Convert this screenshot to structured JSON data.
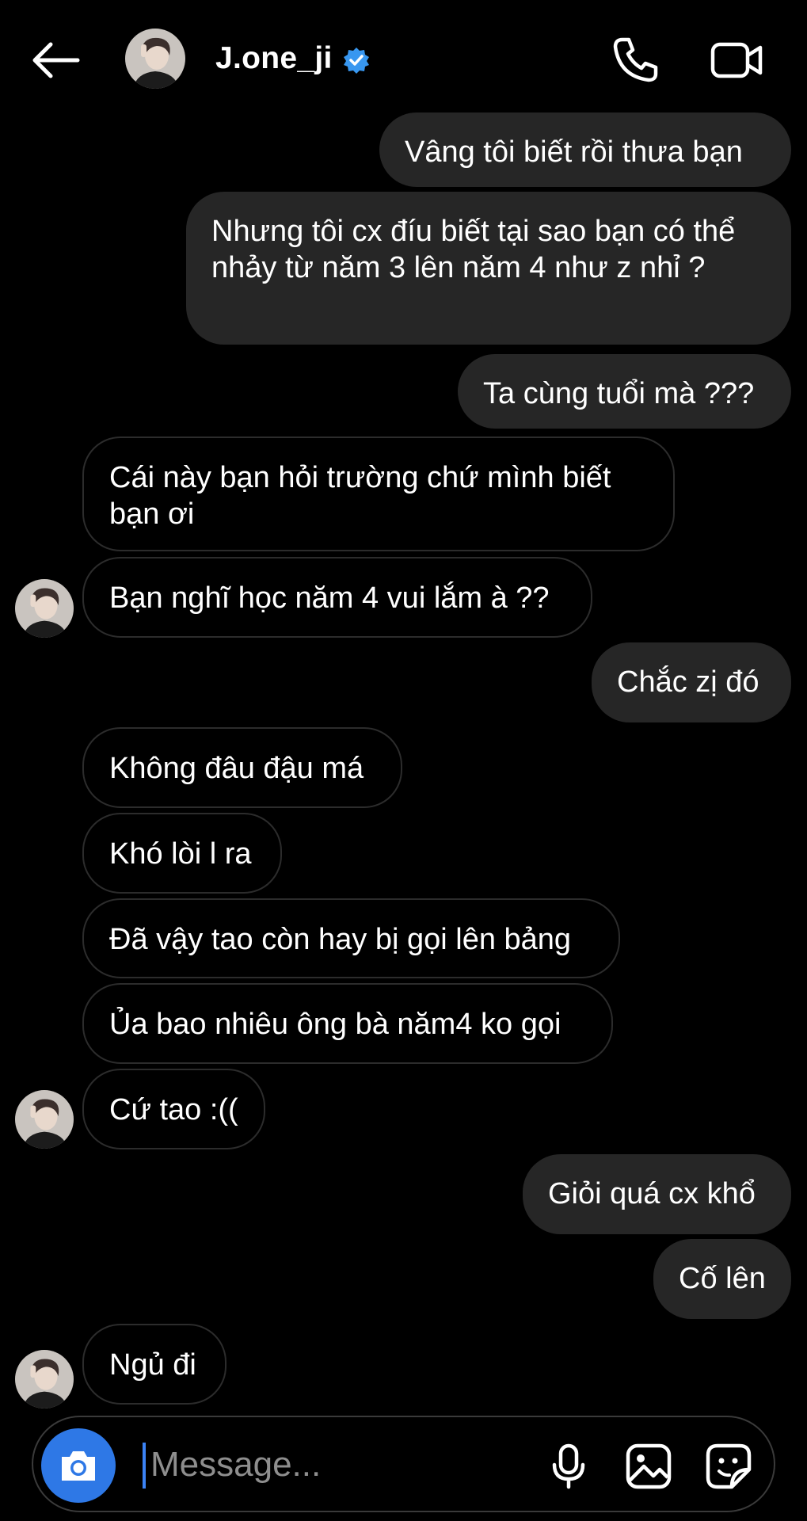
{
  "header": {
    "username": "J.one_ji",
    "verified": true
  },
  "messages": [
    {
      "from": "me",
      "text": "Vâng tôi biết rồi thưa bạn"
    },
    {
      "from": "me",
      "text": "Nhưng tôi cx đíu biết tại sao bạn có thể nhảy từ năm 3 lên năm 4 như z nhỉ ?"
    },
    {
      "from": "me",
      "text": "Ta cùng tuổi mà ???"
    },
    {
      "from": "them",
      "text": "Cái này bạn hỏi trường chứ mình biết bạn ơi"
    },
    {
      "from": "them",
      "text": "Bạn nghĩ học năm 4 vui lắm à ??"
    },
    {
      "from": "me",
      "text": "Chắc zị đó"
    },
    {
      "from": "them",
      "text": "Không đâu đậu má"
    },
    {
      "from": "them",
      "text": "Khó lòi l ra"
    },
    {
      "from": "them",
      "text": "Đã vậy tao còn hay bị gọi lên bảng"
    },
    {
      "from": "them",
      "text": "Ủa bao nhiêu ông bà năm4 ko gọi"
    },
    {
      "from": "them",
      "text": "Cứ tao :(("
    },
    {
      "from": "me",
      "text": "Giỏi quá cx khổ"
    },
    {
      "from": "me",
      "text": "Cố lên"
    },
    {
      "from": "them",
      "text": "Ngủ đi"
    }
  ],
  "composer": {
    "placeholder": "Message..."
  },
  "colors": {
    "background": "#000000",
    "sent_bubble": "#262626",
    "accent": "#3897f0",
    "camera_button": "#2e78e6"
  },
  "icons": [
    "back-arrow-icon",
    "verified-badge-icon",
    "phone-icon",
    "video-camera-icon",
    "camera-icon",
    "microphone-icon",
    "gallery-icon",
    "sticker-icon"
  ]
}
